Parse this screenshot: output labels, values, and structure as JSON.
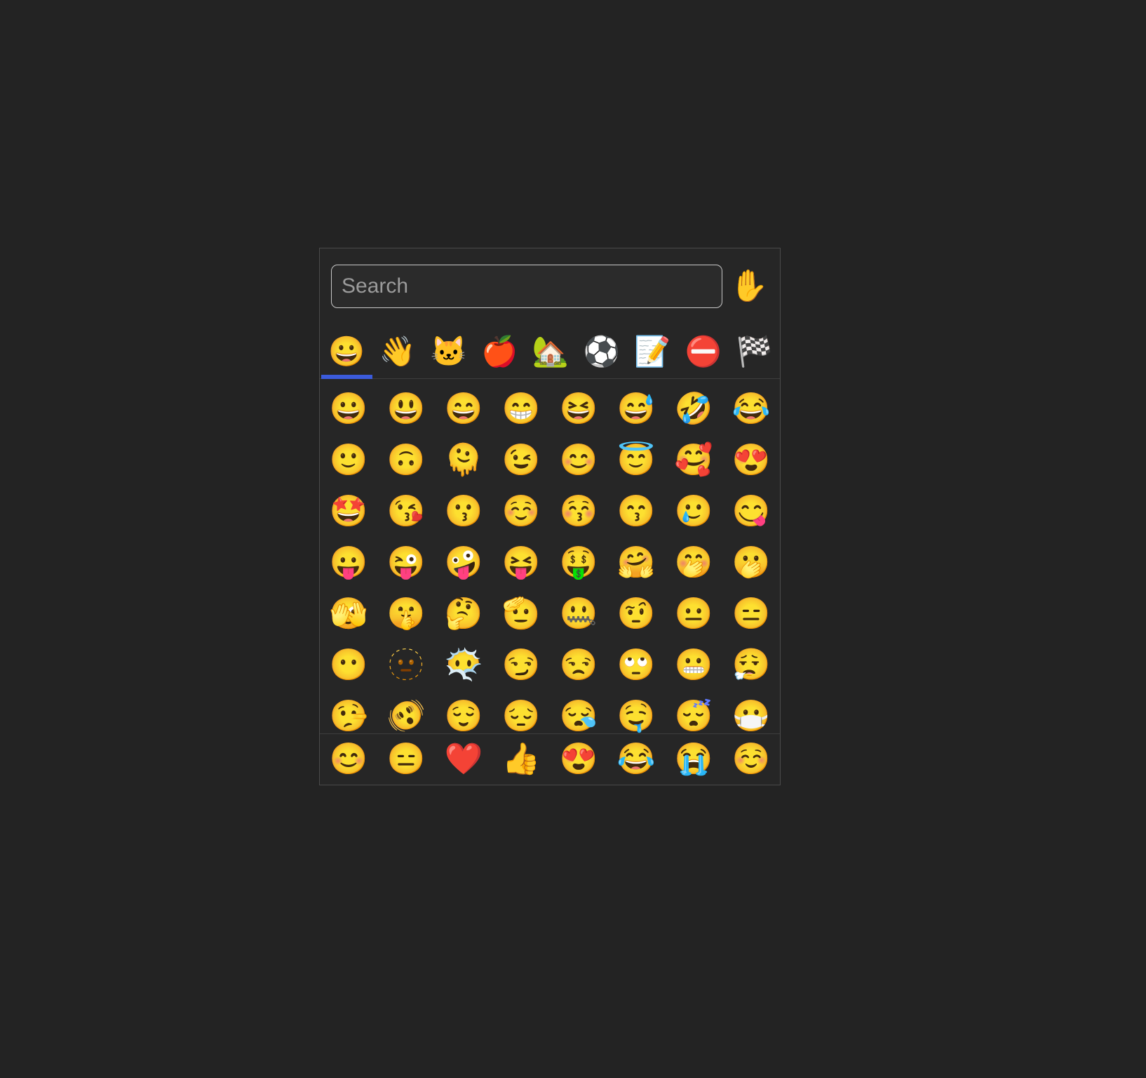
{
  "theme": {
    "page_background": "#232323",
    "panel_background": "#262626",
    "panel_border": "#4a4a4a",
    "divider": "#3d3d3d",
    "accent": "#3b5bdb",
    "placeholder_text": "#9b9b9b",
    "input_border": "#c9c9c9"
  },
  "search": {
    "placeholder": "Search",
    "value": "",
    "icon_name": "search-input"
  },
  "skin_tone": {
    "glyph": "✋",
    "icon_name": "raised-hand-icon",
    "label": "Skin tone selector"
  },
  "tabs": [
    {
      "glyph": "😀",
      "name": "tab-smileys-and-emotion",
      "label": "Smileys & Emotion",
      "active": true
    },
    {
      "glyph": "👋",
      "name": "tab-people-and-body",
      "label": "People & Body",
      "active": false
    },
    {
      "glyph": "🐱",
      "name": "tab-animals-and-nature",
      "label": "Animals & Nature",
      "active": false
    },
    {
      "glyph": "🍎",
      "name": "tab-food-and-drink",
      "label": "Food & Drink",
      "active": false
    },
    {
      "glyph": "🏡",
      "name": "tab-travel-and-places",
      "label": "Travel & Places",
      "active": false
    },
    {
      "glyph": "⚽",
      "name": "tab-activities",
      "label": "Activities",
      "active": false
    },
    {
      "glyph": "📝",
      "name": "tab-objects",
      "label": "Objects",
      "active": false
    },
    {
      "glyph": "⛔",
      "name": "tab-symbols",
      "label": "Symbols",
      "active": false
    },
    {
      "glyph": "🏁",
      "name": "tab-flags",
      "label": "Flags",
      "active": false
    }
  ],
  "grid": {
    "columns": 8,
    "emojis": [
      {
        "glyph": "😀",
        "label": "grinning face"
      },
      {
        "glyph": "😃",
        "label": "grinning face with big eyes"
      },
      {
        "glyph": "😄",
        "label": "grinning face with smiling eyes"
      },
      {
        "glyph": "😁",
        "label": "beaming face with smiling eyes"
      },
      {
        "glyph": "😆",
        "label": "grinning squinting face"
      },
      {
        "glyph": "😅",
        "label": "grinning face with sweat"
      },
      {
        "glyph": "🤣",
        "label": "rolling on the floor laughing"
      },
      {
        "glyph": "😂",
        "label": "face with tears of joy"
      },
      {
        "glyph": "🙂",
        "label": "slightly smiling face"
      },
      {
        "glyph": "🙃",
        "label": "upside-down face"
      },
      {
        "glyph": "🫠",
        "label": "melting face"
      },
      {
        "glyph": "😉",
        "label": "winking face"
      },
      {
        "glyph": "😊",
        "label": "smiling face with smiling eyes"
      },
      {
        "glyph": "😇",
        "label": "smiling face with halo"
      },
      {
        "glyph": "🥰",
        "label": "smiling face with hearts"
      },
      {
        "glyph": "😍",
        "label": "smiling face with heart-eyes"
      },
      {
        "glyph": "🤩",
        "label": "star-struck"
      },
      {
        "glyph": "😘",
        "label": "face blowing a kiss"
      },
      {
        "glyph": "😗",
        "label": "kissing face"
      },
      {
        "glyph": "☺️",
        "label": "smiling face"
      },
      {
        "glyph": "😚",
        "label": "kissing face with closed eyes"
      },
      {
        "glyph": "😙",
        "label": "kissing face with smiling eyes"
      },
      {
        "glyph": "🥲",
        "label": "smiling face with tear"
      },
      {
        "glyph": "😋",
        "label": "face savoring food"
      },
      {
        "glyph": "😛",
        "label": "face with tongue"
      },
      {
        "glyph": "😜",
        "label": "winking face with tongue"
      },
      {
        "glyph": "🤪",
        "label": "zany face"
      },
      {
        "glyph": "😝",
        "label": "squinting face with tongue"
      },
      {
        "glyph": "🤑",
        "label": "money-mouth face"
      },
      {
        "glyph": "🤗",
        "label": "smiling face with open hands"
      },
      {
        "glyph": "🤭",
        "label": "face with hand over mouth"
      },
      {
        "glyph": "🫢",
        "label": "face with open eyes and hand over mouth"
      },
      {
        "glyph": "🫣",
        "label": "face with peeking eye"
      },
      {
        "glyph": "🤫",
        "label": "shushing face"
      },
      {
        "glyph": "🤔",
        "label": "thinking face"
      },
      {
        "glyph": "🫡",
        "label": "saluting face"
      },
      {
        "glyph": "🤐",
        "label": "zipper-mouth face"
      },
      {
        "glyph": "🤨",
        "label": "face with raised eyebrow"
      },
      {
        "glyph": "😐",
        "label": "neutral face"
      },
      {
        "glyph": "😑",
        "label": "expressionless face"
      },
      {
        "glyph": "😶",
        "label": "face without mouth"
      },
      {
        "glyph": "🫥",
        "label": "dotted line face"
      },
      {
        "glyph": "😶‍🌫️",
        "label": "face in clouds"
      },
      {
        "glyph": "😏",
        "label": "smirking face"
      },
      {
        "glyph": "😒",
        "label": "unamused face"
      },
      {
        "glyph": "🙄",
        "label": "face with rolling eyes"
      },
      {
        "glyph": "😬",
        "label": "grimacing face"
      },
      {
        "glyph": "😮‍💨",
        "label": "face exhaling"
      },
      {
        "glyph": "🤥",
        "label": "lying face"
      },
      {
        "glyph": "🫨",
        "label": "shaking face"
      },
      {
        "glyph": "😌",
        "label": "relieved face"
      },
      {
        "glyph": "😔",
        "label": "pensive face"
      },
      {
        "glyph": "😪",
        "label": "sleepy face"
      },
      {
        "glyph": "🤤",
        "label": "drooling face"
      },
      {
        "glyph": "😴",
        "label": "sleeping face"
      },
      {
        "glyph": "😷",
        "label": "face with medical mask"
      }
    ]
  },
  "frequently_used": {
    "emojis": [
      {
        "glyph": "😊",
        "label": "smiling face with smiling eyes"
      },
      {
        "glyph": "😑",
        "label": "expressionless face"
      },
      {
        "glyph": "❤️",
        "label": "red heart"
      },
      {
        "glyph": "👍",
        "label": "thumbs up"
      },
      {
        "glyph": "😍",
        "label": "smiling face with heart-eyes"
      },
      {
        "glyph": "😂",
        "label": "face with tears of joy"
      },
      {
        "glyph": "😭",
        "label": "loudly crying face"
      },
      {
        "glyph": "☺️",
        "label": "smiling face"
      }
    ]
  }
}
